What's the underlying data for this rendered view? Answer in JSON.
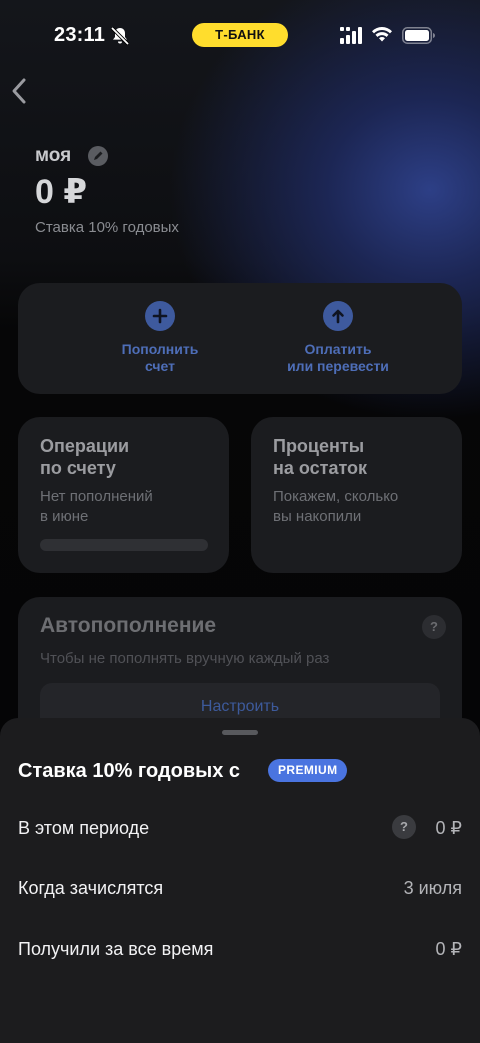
{
  "status_bar": {
    "time": "23:11",
    "bank_label": "Т-БАНК"
  },
  "account": {
    "name": "моя",
    "balance": "0 ₽",
    "rate": "Ставка 10% годовых"
  },
  "actions": [
    {
      "label": "Пополнить\nсчет",
      "icon": "plus-icon"
    },
    {
      "label": "Оплатить\nили перевести",
      "icon": "arrow-up-icon"
    }
  ],
  "cards": {
    "operations": {
      "title": "Операции\nпо счету",
      "sub": "Нет пополнений\nв июне"
    },
    "interest": {
      "title": "Проценты\nна остаток",
      "sub": "Покажем, сколько\nвы накопили"
    }
  },
  "autofill": {
    "title": "Автопополнение",
    "sub": "Чтобы не пополнять вручную каждый раз",
    "help": "?",
    "button": "Настроить"
  },
  "sheet": {
    "title": "Ставка 10% годовых с",
    "badge": "PREMIUM",
    "rows": [
      {
        "label": "В этом периоде",
        "value": "0 ₽",
        "help": "?"
      },
      {
        "label": "Когда зачислятся",
        "value": "3 июля"
      },
      {
        "label": "Получили за все время",
        "value": "0 ₽"
      }
    ]
  },
  "colors": {
    "accent": "#4a74e0",
    "bank_yellow": "#ffdd2d",
    "card_bg": "#1b1c1f",
    "sheet_bg": "#1c1c1e"
  }
}
